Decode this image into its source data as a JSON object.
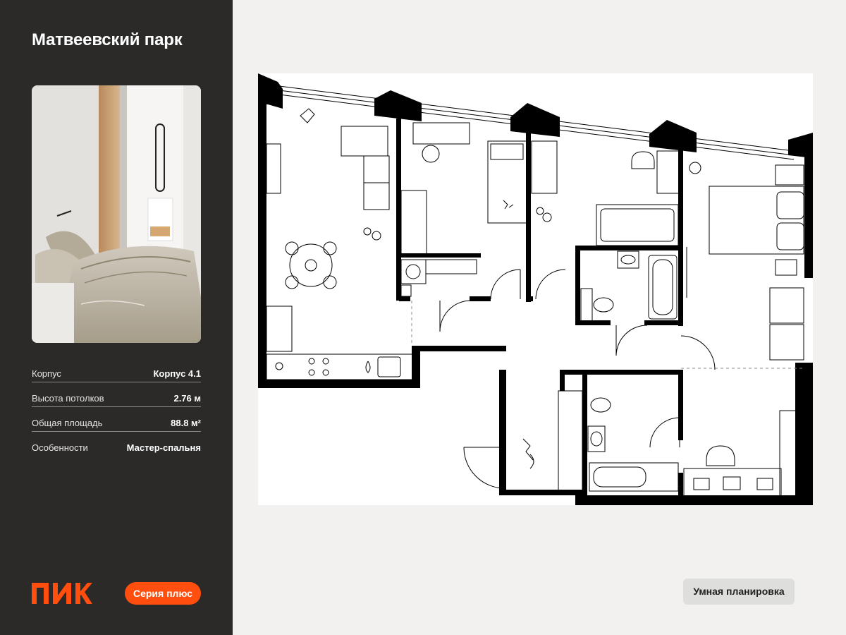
{
  "project": {
    "title": "Матвеевский парк"
  },
  "specs": [
    {
      "label": "Корпус",
      "value": "Корпус 4.1"
    },
    {
      "label": "Высота потолков",
      "value": "2.76 м"
    },
    {
      "label": "Общая площадь",
      "value": "88.8 м²"
    },
    {
      "label": "Особенности",
      "value": "Мастер-спальня"
    }
  ],
  "brand": {
    "logo_text": "ПИК",
    "series_label": "Серия плюс",
    "accent_color": "#ff4e0d"
  },
  "plan": {
    "smart_layout_label": "Умная планировка"
  },
  "colors": {
    "sidebar_bg": "#2b2a29",
    "page_bg": "#f2f1ef",
    "wall": "#000000"
  }
}
